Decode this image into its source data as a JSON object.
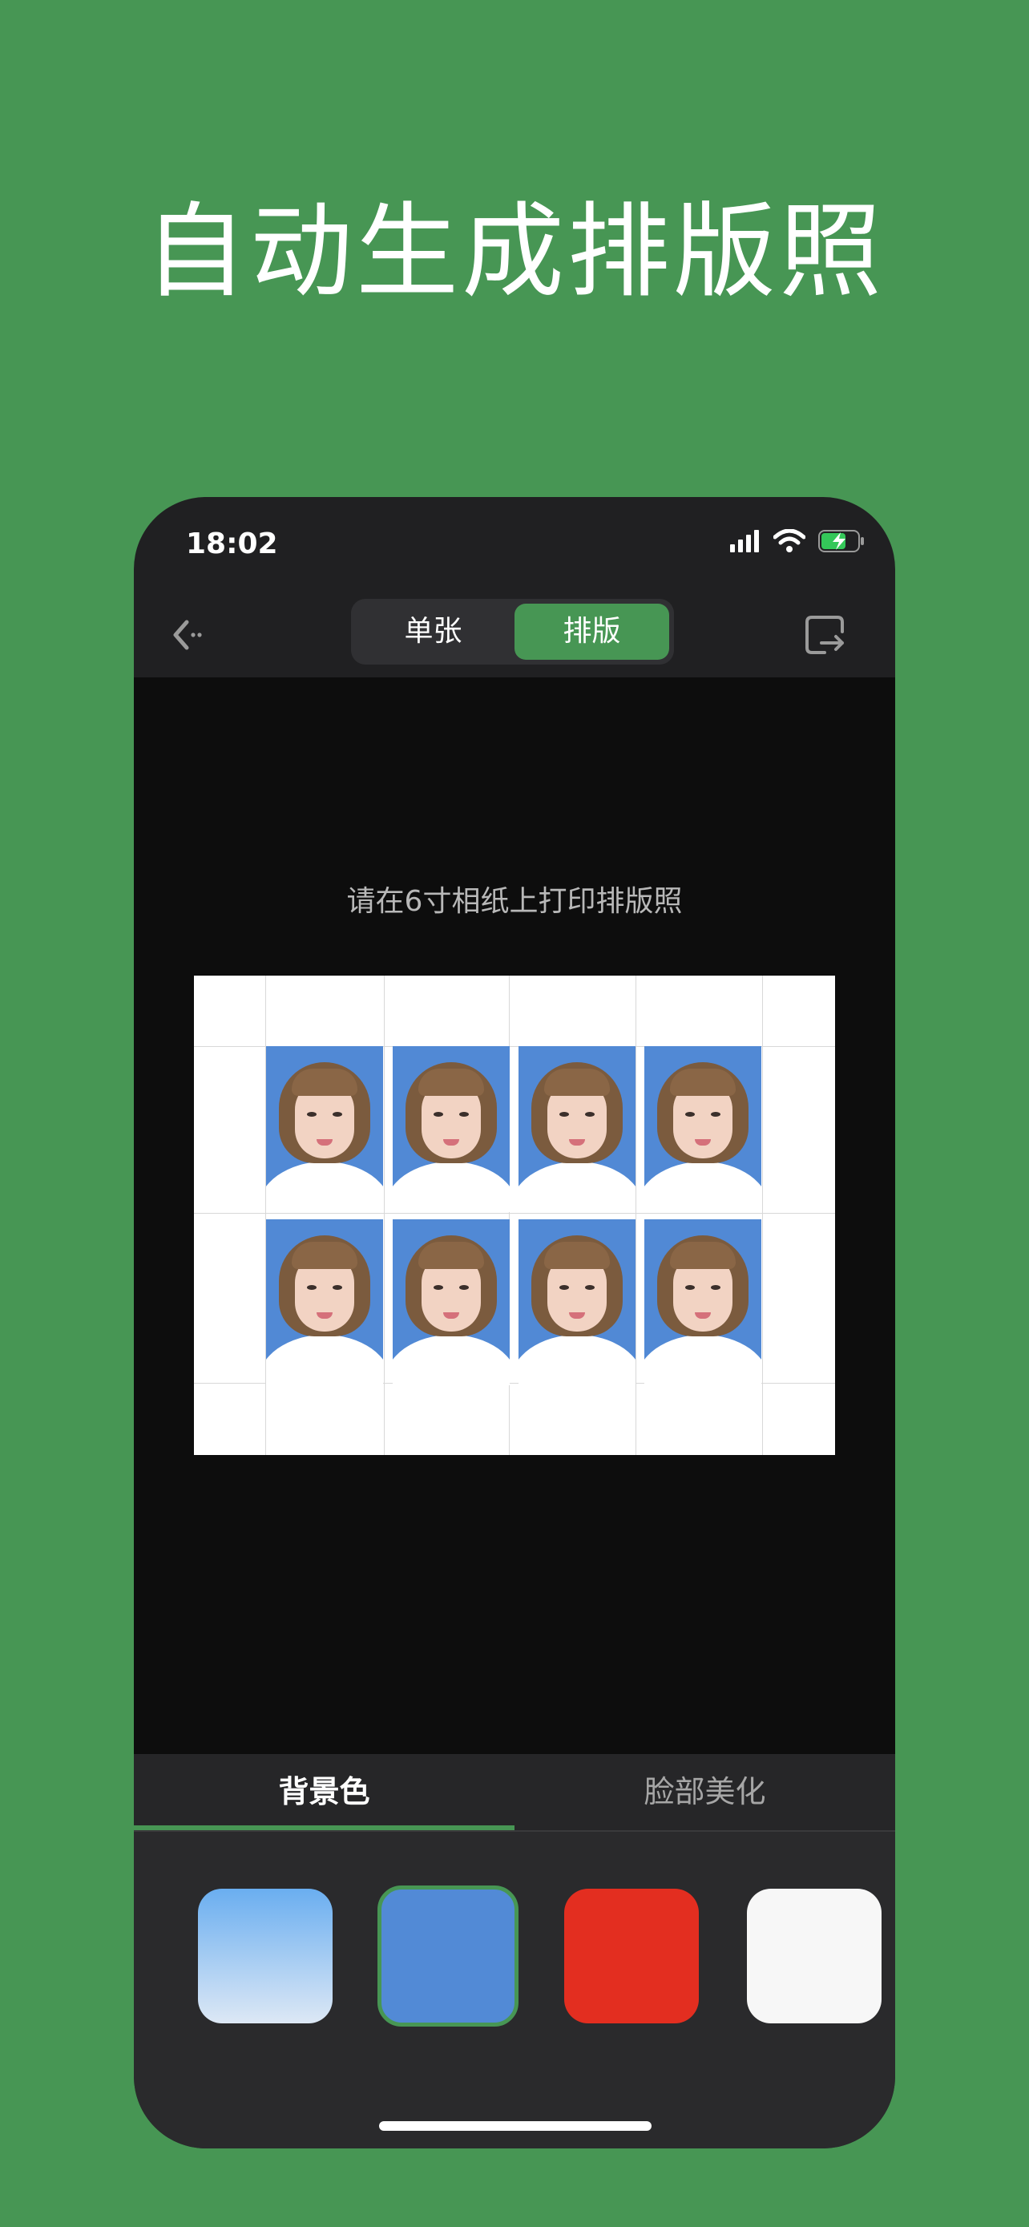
{
  "headline": "自动生成排版照",
  "status_bar": {
    "time": "18:02",
    "icons": [
      "cellular-signal-icon",
      "wifi-icon",
      "battery-charging-icon"
    ]
  },
  "nav": {
    "back_icon": "back-arrow-icon",
    "segments": [
      "单张",
      "排版"
    ],
    "selected_segment": "排版",
    "export_icon": "export-icon"
  },
  "canvas": {
    "instruction": "请在6寸相纸上打印排版照",
    "photo_count": 8,
    "photo_background": "#5189d5"
  },
  "panel": {
    "tabs": [
      "背景色",
      "脸部美化"
    ],
    "selected_tab": "背景色",
    "swatches": [
      {
        "name": "light-blue-gradient",
        "color": "#6aaef0"
      },
      {
        "name": "blue",
        "color": "#528ad6",
        "selected": true
      },
      {
        "name": "red",
        "color": "#e32e20"
      },
      {
        "name": "white",
        "color": "#f7f7f7"
      }
    ]
  },
  "accent": "#479654"
}
